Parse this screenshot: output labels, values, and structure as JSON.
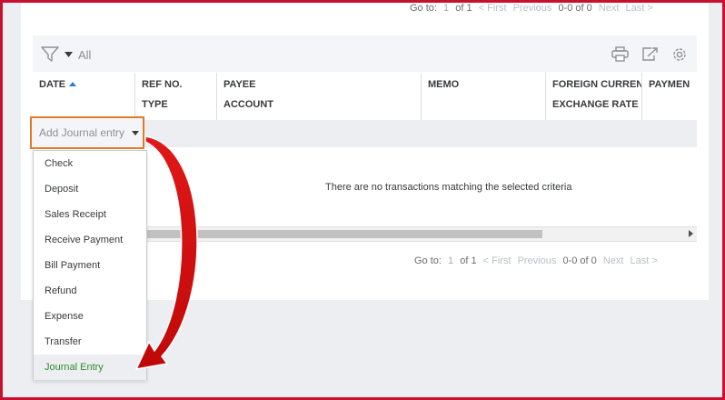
{
  "pager_top": {
    "goto_label": "Go to:",
    "page": "1",
    "of": "of 1",
    "first": "< First",
    "previous": "Previous",
    "range": "0-0 of 0",
    "next": "Next",
    "last": "Last >"
  },
  "pager_bottom": {
    "goto_label": "Go to:",
    "page": "1",
    "of": "of 1",
    "first": "< First",
    "previous": "Previous",
    "range": "0-0 of 0",
    "next": "Next",
    "last": "Last >"
  },
  "toolbar": {
    "filter_label": "All",
    "icons": [
      "filter-icon",
      "print-icon",
      "export-icon",
      "settings-icon"
    ]
  },
  "table": {
    "columns": [
      {
        "line1": "DATE",
        "line2": ""
      },
      {
        "line1": "REF NO.",
        "line2": "TYPE"
      },
      {
        "line1": "PAYEE",
        "line2": "ACCOUNT"
      },
      {
        "line1": "MEMO",
        "line2": ""
      },
      {
        "line1": "FOREIGN CURRENC",
        "line2": "EXCHANGE RATE"
      },
      {
        "line1": "PAYMEN",
        "line2": ""
      }
    ],
    "empty_message": "There are no transactions matching the selected criteria"
  },
  "action": {
    "add_label": "Add Journal entry"
  },
  "menu": {
    "items": [
      "Check",
      "Deposit",
      "Sales Receipt",
      "Receive Payment",
      "Bill Payment",
      "Refund",
      "Expense",
      "Transfer",
      "Journal Entry"
    ],
    "active_index": 8
  },
  "colors": {
    "highlight_border": "#e07b2a",
    "arrow": "#d01010",
    "active_item": "#2e8b2e",
    "frame": "#c8102e"
  }
}
